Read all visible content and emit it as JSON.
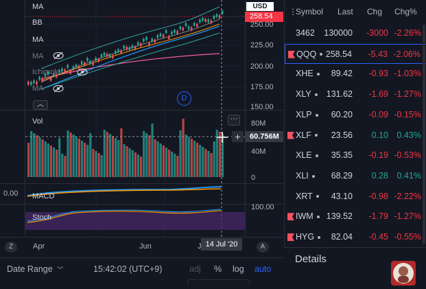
{
  "chart": {
    "currency": "USD",
    "indicators": {
      "ma1": "MA",
      "bb": "BB",
      "ma2": "MA",
      "ma3": "MA",
      "ichimoku": "Ichimoku",
      "ma4": "MA"
    },
    "price_axis": [
      "250.00",
      "225.00",
      "200.00",
      "175.00",
      "150.00"
    ],
    "price_tag": "258.54",
    "volume_label": "Vol",
    "volume_axis": [
      "80M",
      "40M",
      "0"
    ],
    "volume_tag": "60.756M",
    "macd_label": "MACD",
    "macd_axis_left": "0.00",
    "stoch_label": "Stoch",
    "stoch_axis": "100.00",
    "time_labels": [
      "Apr",
      "Jun",
      "Jul"
    ],
    "crosshair_date": "14 Jul '20",
    "d_badge": "D",
    "z_badge": "Z",
    "a_badge": "A"
  },
  "bottom_bar": {
    "date_range": "Date Range",
    "time": "15:42:02 (UTC+9)",
    "adj": "adj",
    "percent": "%",
    "log": "log",
    "auto": "auto"
  },
  "watchlist": {
    "headers": {
      "symbol": "Symbol",
      "last": "Last",
      "chg": "Chg",
      "pct": "Chg%"
    },
    "rows": [
      {
        "symbol": "3462",
        "last": "130000",
        "chg": "-3000",
        "pct": "-2.26%",
        "dir": "neg",
        "flag": false,
        "dot": false
      },
      {
        "symbol": "QQQ",
        "last": "258.54",
        "chg": "-5.43",
        "pct": "-2.06%",
        "dir": "neg",
        "flag": true,
        "dot": true,
        "selected": true
      },
      {
        "symbol": "XHE",
        "last": "89.42",
        "chg": "-0.93",
        "pct": "-1.03%",
        "dir": "neg",
        "flag": false,
        "dot": true
      },
      {
        "symbol": "XLY",
        "last": "131.62",
        "chg": "-1.69",
        "pct": "-1.27%",
        "dir": "neg",
        "flag": false,
        "dot": true
      },
      {
        "symbol": "XLP",
        "last": "60.20",
        "chg": "-0.09",
        "pct": "-0.15%",
        "dir": "neg",
        "flag": false,
        "dot": true
      },
      {
        "symbol": "XLF",
        "last": "23.56",
        "chg": "0.10",
        "pct": "0.43%",
        "dir": "pos",
        "flag": true,
        "dot": true
      },
      {
        "symbol": "XLE",
        "last": "35.35",
        "chg": "-0.19",
        "pct": "-0.53%",
        "dir": "neg",
        "flag": false,
        "dot": true
      },
      {
        "symbol": "XLI",
        "last": "68.29",
        "chg": "0.28",
        "pct": "0.41%",
        "dir": "pos",
        "flag": false,
        "dot": true
      },
      {
        "symbol": "XRT",
        "last": "43.10",
        "chg": "-0.98",
        "pct": "-2.22%",
        "dir": "neg",
        "flag": false,
        "dot": true
      },
      {
        "symbol": "IWM",
        "last": "139.52",
        "chg": "-1.79",
        "pct": "-1.27%",
        "dir": "neg",
        "flag": true,
        "dot": true
      },
      {
        "symbol": "HYG",
        "last": "82.04",
        "chg": "-0.45",
        "pct": "-0.55%",
        "dir": "neg",
        "flag": true,
        "dot": true
      }
    ]
  },
  "details": {
    "title": "Details"
  },
  "colors": {
    "up": "#26a69a",
    "down": "#ef5350",
    "accent": "#2962ff",
    "bg": "#131722"
  }
}
